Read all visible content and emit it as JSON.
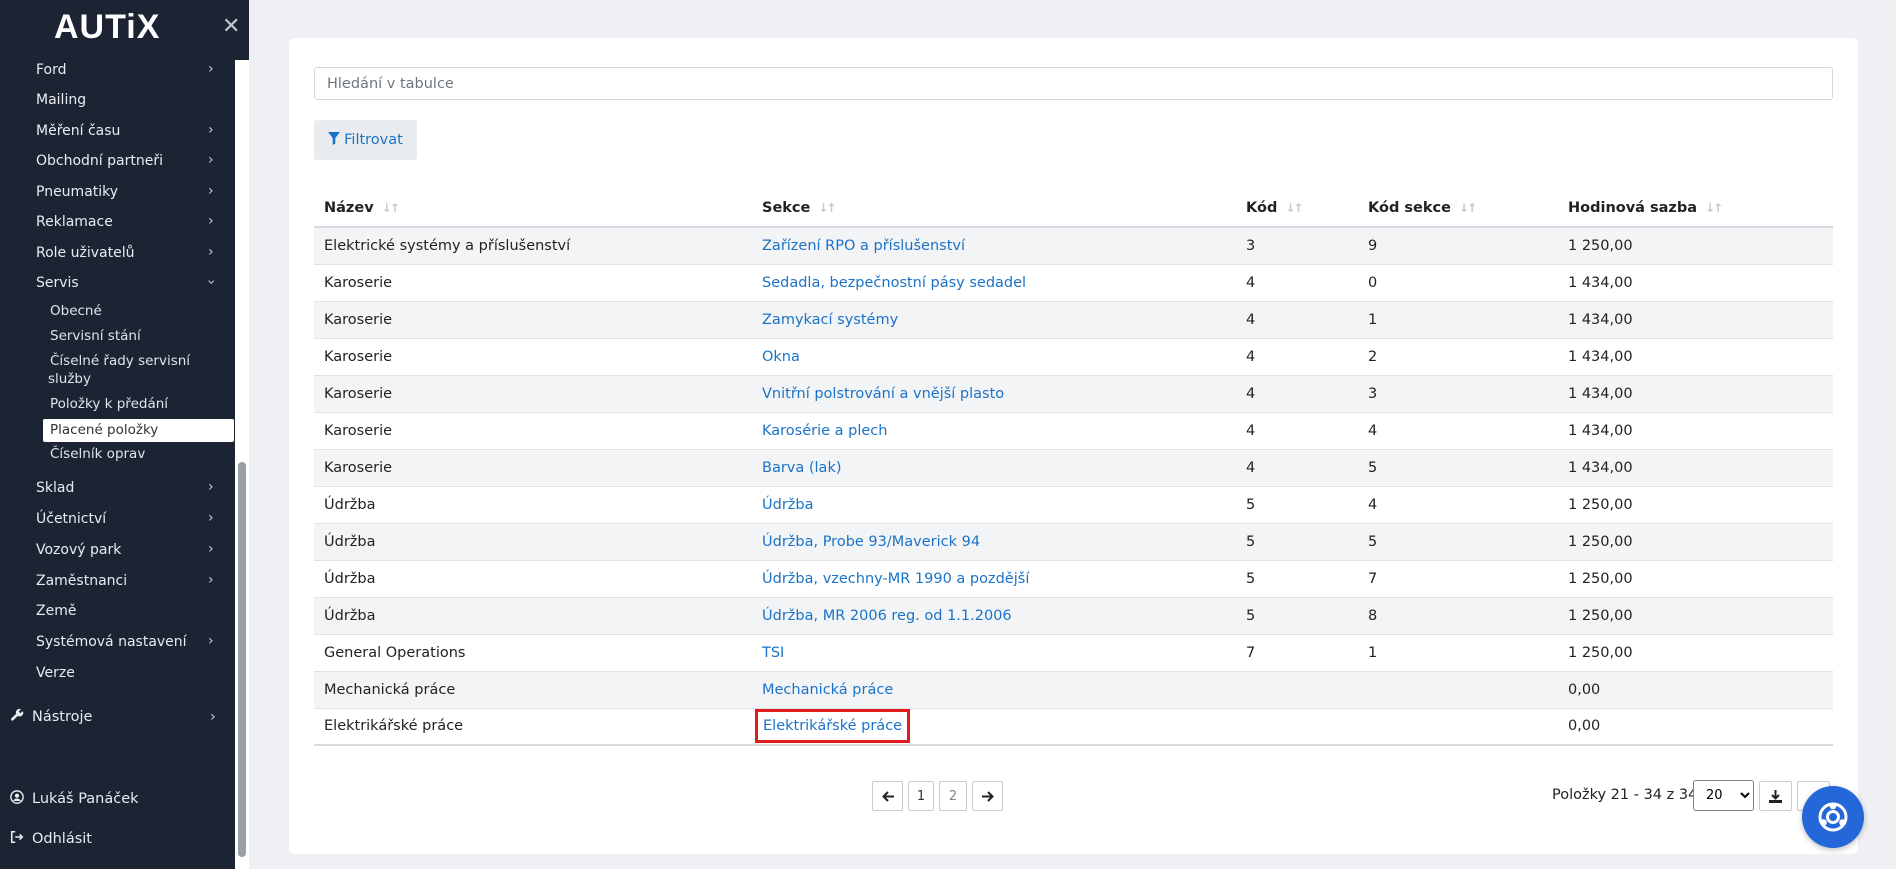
{
  "sidebar": {
    "logo": "AUTiX",
    "close_icon": "close-icon",
    "items": [
      {
        "label": "Ford",
        "has_chevron": true
      },
      {
        "label": "Mailing",
        "has_chevron": false
      },
      {
        "label": "Měření času",
        "has_chevron": true
      },
      {
        "label": "Obchodní partneři",
        "has_chevron": true
      },
      {
        "label": "Pneumatiky",
        "has_chevron": true
      },
      {
        "label": "Reklamace",
        "has_chevron": true
      },
      {
        "label": "Role uživatelů",
        "has_chevron": true
      },
      {
        "label": "Servis",
        "has_chevron": true,
        "expanded": true
      }
    ],
    "servis_sub": [
      {
        "label": "Obecné"
      },
      {
        "label": "Servisní stání"
      },
      {
        "label": "Číselné řady servisní"
      },
      {
        "label": "služby"
      },
      {
        "label": "Položky k předání"
      },
      {
        "label": "Placené položky",
        "active": true
      },
      {
        "label": "Číselník oprav"
      }
    ],
    "items_after": [
      {
        "label": "Sklad",
        "has_chevron": true
      },
      {
        "label": "Účetnictví",
        "has_chevron": true
      },
      {
        "label": "Vozový park",
        "has_chevron": true
      },
      {
        "label": "Zaměstnanci",
        "has_chevron": true
      },
      {
        "label": "Země",
        "has_chevron": false
      },
      {
        "label": "Systémová nastavení",
        "has_chevron": true
      },
      {
        "label": "Verze",
        "has_chevron": false
      }
    ],
    "tools": {
      "label": "Nástroje",
      "icon": "wrench-icon"
    },
    "user": {
      "label": "Lukáš Panáček",
      "icon": "user-circle-icon"
    },
    "logout": {
      "label": "Odhlásit",
      "icon": "sign-out-icon"
    }
  },
  "main": {
    "search": {
      "placeholder": "Hledání v tabulce",
      "value": ""
    },
    "filter_button": {
      "label": "Filtrovat",
      "icon": "filter-icon"
    },
    "table": {
      "columns": [
        "Název",
        "Sekce",
        "Kód",
        "Kód sekce",
        "Hodinová sazba"
      ],
      "rows": [
        [
          "Elektrické systémy a příslušenství",
          "Zařízení RPO a příslušenství",
          "3",
          "9",
          "1 250,00"
        ],
        [
          "Karoserie",
          "Sedadla, bezpečnostní pásy sedadel",
          "4",
          "0",
          "1 434,00"
        ],
        [
          "Karoserie",
          "Zamykací systémy",
          "4",
          "1",
          "1 434,00"
        ],
        [
          "Karoserie",
          "Okna",
          "4",
          "2",
          "1 434,00"
        ],
        [
          "Karoserie",
          "Vnitřní polstrování a vnější plasto",
          "4",
          "3",
          "1 434,00"
        ],
        [
          "Karoserie",
          "Karosérie a plech",
          "4",
          "4",
          "1 434,00"
        ],
        [
          "Karoserie",
          "Barva (lak)",
          "4",
          "5",
          "1 434,00"
        ],
        [
          "Údržba",
          "Údržba",
          "5",
          "4",
          "1 250,00"
        ],
        [
          "Údržba",
          "Údržba, Probe 93/Maverick 94",
          "5",
          "5",
          "1 250,00"
        ],
        [
          "Údržba",
          "Údržba, vzechny-MR 1990 a pozdější",
          "5",
          "7",
          "1 250,00"
        ],
        [
          "Údržba",
          "Údržba, MR 2006 reg. od 1.1.2006",
          "5",
          "8",
          "1 250,00"
        ],
        [
          "General Operations",
          "TSI",
          "7",
          "1",
          "1 250,00"
        ],
        [
          "Mechanická práce",
          "Mechanická práce",
          "",
          "",
          "0,00"
        ],
        [
          "Elektrikářské práce",
          "Elektrikářské práce",
          "",
          "",
          "0,00"
        ]
      ],
      "highlighted_row": 13
    },
    "pagination": {
      "prev_icon": "arrow-left-icon",
      "pages": [
        "1",
        "2"
      ],
      "current_page": "1",
      "next_icon": "arrow-right-icon",
      "info": "Položky 21 - 34 z 34",
      "page_size": "20",
      "page_size_options": [
        "20"
      ],
      "download_icon": "download-icon"
    },
    "fab": {
      "icon": "support-lifebuoy-icon"
    }
  }
}
